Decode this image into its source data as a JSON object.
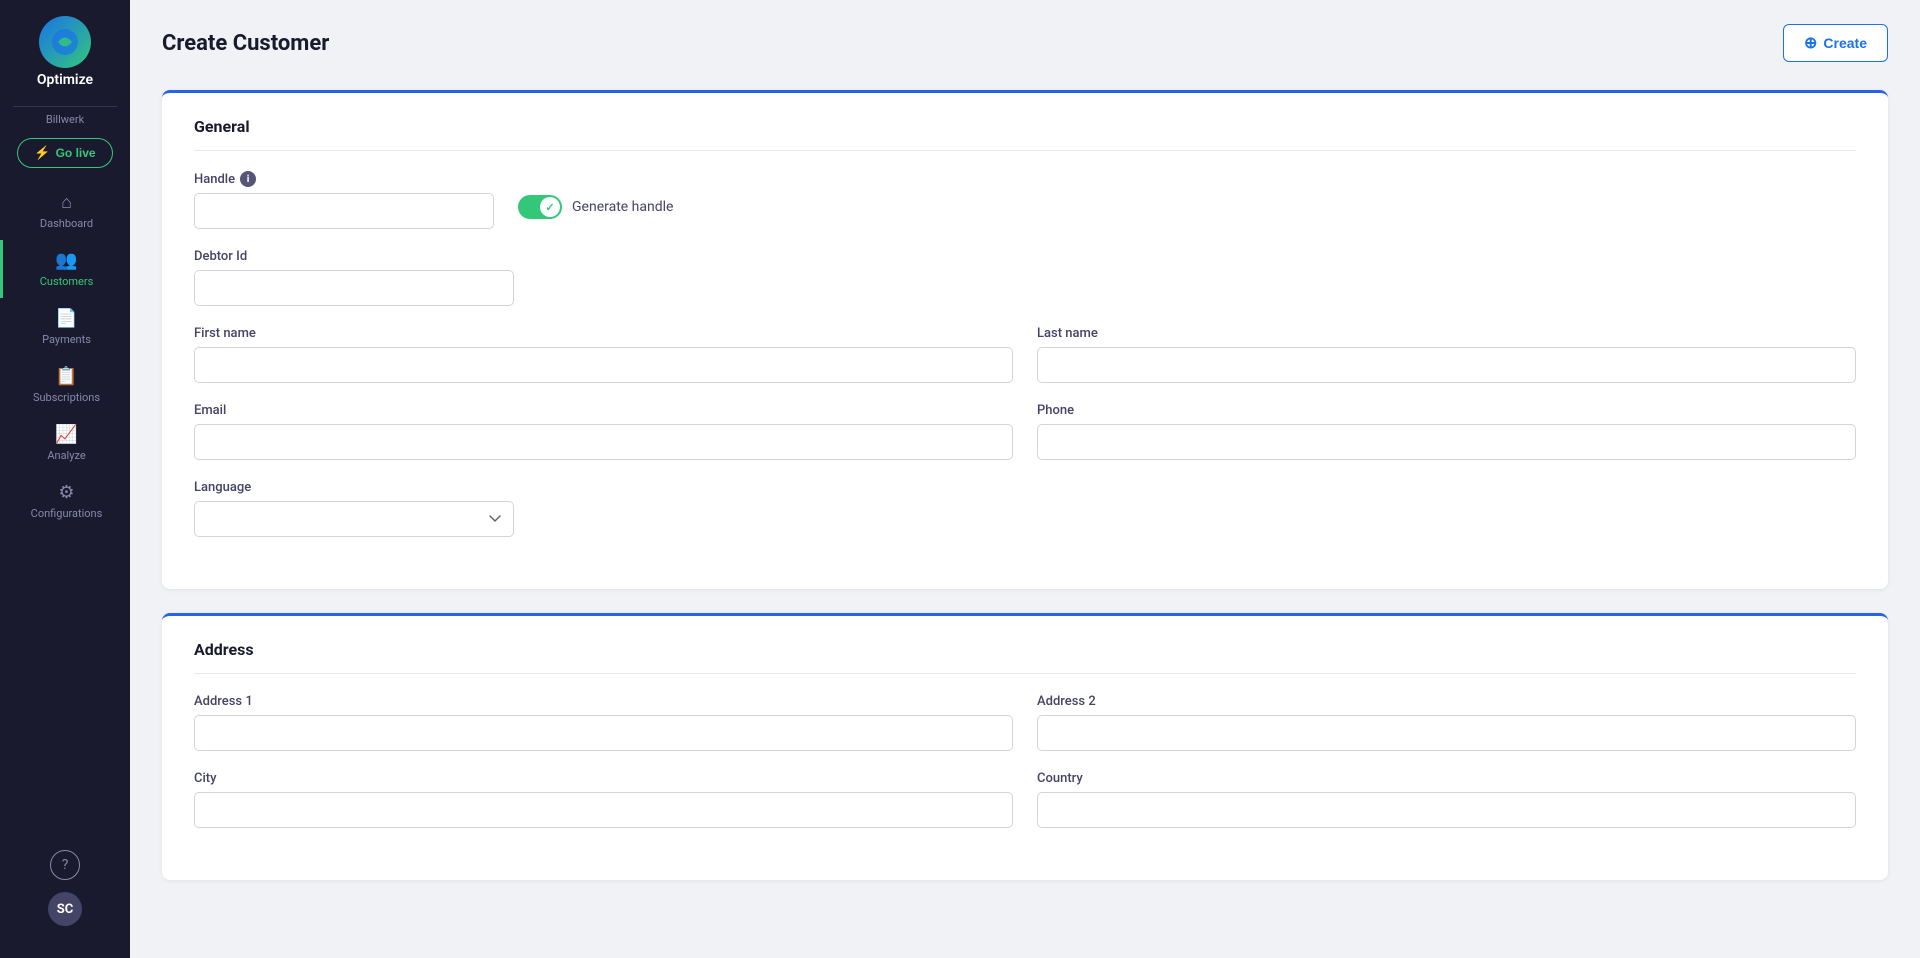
{
  "app": {
    "name": "Optimize",
    "go_live_label": "Go live"
  },
  "sidebar": {
    "items": [
      {
        "id": "dashboard",
        "label": "Dashboard",
        "icon": "⌂",
        "active": false
      },
      {
        "id": "customers",
        "label": "Customers",
        "icon": "👥",
        "active": true
      },
      {
        "id": "payments",
        "label": "Payments",
        "icon": "📄",
        "active": false
      },
      {
        "id": "subscriptions",
        "label": "Subscriptions",
        "icon": "📋",
        "active": false
      },
      {
        "id": "analyze",
        "label": "Analyze",
        "icon": "📈",
        "active": false
      },
      {
        "id": "configurations",
        "label": "Configurations",
        "icon": "⚙",
        "active": false
      }
    ],
    "sub_label": "Billwerk"
  },
  "header": {
    "title": "Create Customer",
    "create_button": "Create"
  },
  "general_section": {
    "title": "General",
    "handle_label": "Handle",
    "handle_info": "i",
    "generate_handle_label": "Generate handle",
    "debtor_id_label": "Debtor Id",
    "first_name_label": "First name",
    "last_name_label": "Last name",
    "email_label": "Email",
    "phone_label": "Phone",
    "language_label": "Language"
  },
  "address_section": {
    "title": "Address",
    "address1_label": "Address 1",
    "address2_label": "Address 2",
    "city_label": "City",
    "country_label": "Country"
  },
  "user": {
    "initials": "SC"
  }
}
